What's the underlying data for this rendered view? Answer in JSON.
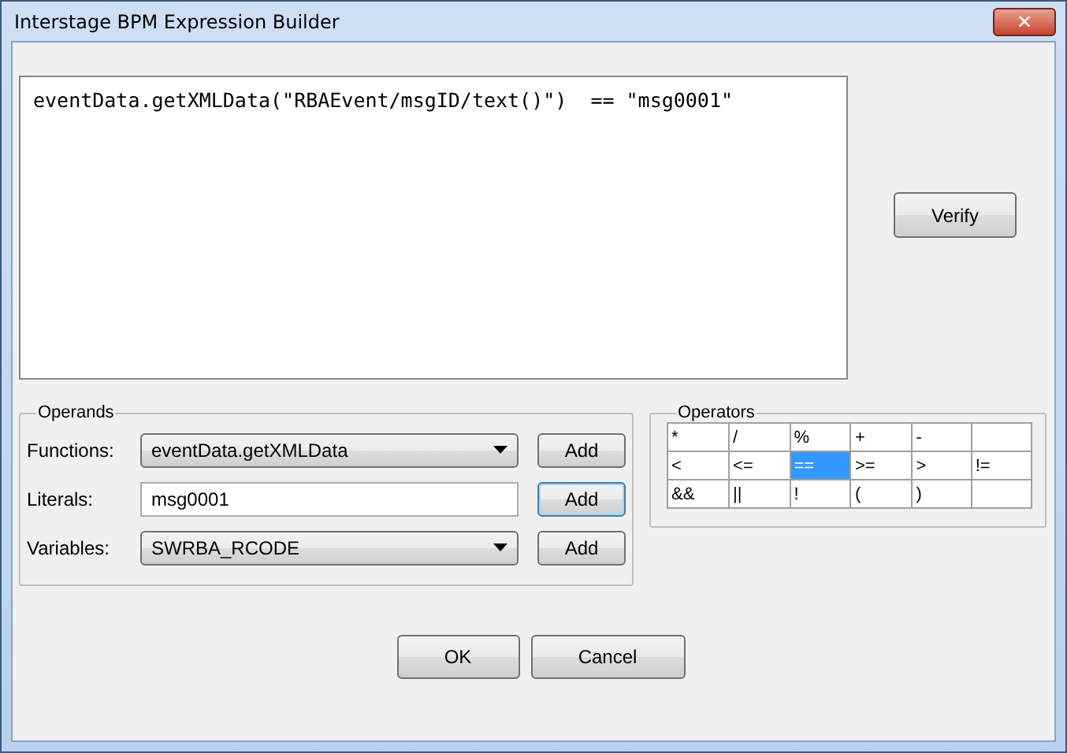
{
  "window": {
    "title": "Interstage BPM Expression Builder",
    "close": "✕"
  },
  "expression": {
    "value": "eventData.getXMLData(\"RBAEvent/msgID/text()\")  == \"msg0001\""
  },
  "verify_button": "Verify",
  "operands": {
    "title": "Operands",
    "rows": [
      {
        "kind": "dropdown",
        "label": "Functions:",
        "value": "eventData.getXMLData",
        "button": "Add",
        "button_focused": false
      },
      {
        "kind": "text",
        "label": "Literals:",
        "value": "msg0001",
        "button": "Add",
        "button_focused": true
      },
      {
        "kind": "dropdown",
        "label": "Variables:",
        "value": "SWRBA_RCODE",
        "button": "Add",
        "button_focused": false
      }
    ]
  },
  "operators": {
    "title": "Operators",
    "rows": [
      [
        {
          "symbol": "*",
          "selected": false
        },
        {
          "symbol": "/",
          "selected": false
        },
        {
          "symbol": "%",
          "selected": false
        },
        {
          "symbol": "+",
          "selected": false
        },
        {
          "symbol": "-",
          "selected": false
        }
      ],
      [
        {
          "symbol": "<",
          "selected": false
        },
        {
          "symbol": "<=",
          "selected": false
        },
        {
          "symbol": "==",
          "selected": true
        },
        {
          "symbol": ">=",
          "selected": false
        },
        {
          "symbol": ">",
          "selected": false
        },
        {
          "symbol": "!=",
          "selected": false
        }
      ],
      [
        {
          "symbol": "&&",
          "selected": false
        },
        {
          "symbol": "||",
          "selected": false
        },
        {
          "symbol": "!",
          "selected": false
        },
        {
          "symbol": "(",
          "selected": false
        },
        {
          "symbol": ")",
          "selected": false
        }
      ]
    ]
  },
  "buttons": [
    "OK",
    "Cancel"
  ]
}
